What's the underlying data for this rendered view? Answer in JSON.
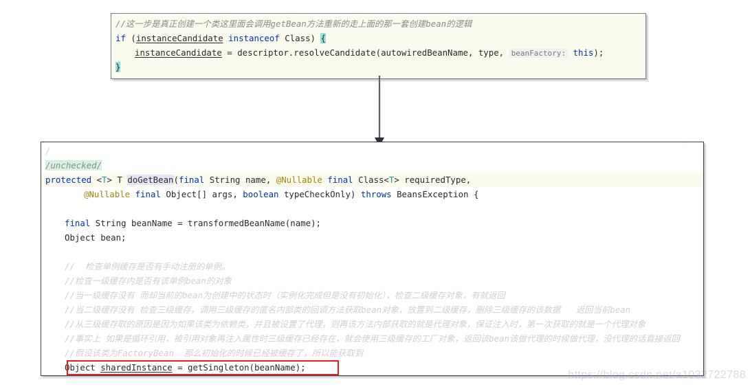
{
  "meta": {
    "watermark": "https://blog.csdn.net/a1032722788",
    "accent_red": "#ee1b24",
    "comment_color": "#8c8c8c",
    "keyword_color": "#0033b3",
    "annotation_color": "#9e880d",
    "faded_comment_color": "#cfcfd6",
    "panel_border": "#3d4046",
    "brace_highlight": "#99e0d8"
  },
  "top_panel": {
    "name": "resolveCandidate snippet",
    "lines": [
      {
        "id": "t1",
        "indent": 0,
        "highlight": "cream",
        "tokens": [
          {
            "t": "//这一步是真正创建一个类这里面会调用getBean方法重新的走上面的那一套创建bean的逻辑",
            "c": "cmt"
          }
        ]
      },
      {
        "id": "t2",
        "indent": 0,
        "highlight": "cream",
        "tokens": [
          {
            "t": "if ",
            "c": "kw"
          },
          {
            "t": "(",
            "c": "plain"
          },
          {
            "t": "instanceCandidate",
            "c": "fld"
          },
          {
            "t": " ",
            "c": "plain"
          },
          {
            "t": "instanceof",
            "c": "kw"
          },
          {
            "t": " Class) ",
            "c": "plain"
          },
          {
            "t": "{",
            "c": "brace"
          }
        ]
      },
      {
        "id": "t3",
        "indent": 1,
        "highlight": "cream",
        "tokens": [
          {
            "t": "instanceCandidate",
            "c": "fld"
          },
          {
            "t": " = descriptor.resolveCandidate(autowiredBeanName, type, ",
            "c": "plain"
          },
          {
            "t": "beanFactory:",
            "c": "hint"
          },
          {
            "t": "this",
            "c": "kw"
          },
          {
            "t": ");",
            "c": "plain"
          }
        ]
      },
      {
        "id": "t4",
        "indent": 0,
        "highlight": "cream",
        "tokens": [
          {
            "t": "}",
            "c": "brace"
          }
        ]
      }
    ]
  },
  "bottom_panel": {
    "name": "doGetBean method",
    "lines": [
      {
        "id": "b0",
        "indent": 0,
        "highlight": "white",
        "tokens": [
          {
            "t": "/",
            "c": "plain-faint"
          }
        ]
      },
      {
        "id": "b1",
        "indent": 0,
        "highlight": "white",
        "tokens": [
          {
            "t": "/unchecked/",
            "c": "cmt-green"
          }
        ]
      },
      {
        "id": "b2",
        "indent": 0,
        "highlight": "cream",
        "tokens": [
          {
            "t": "protected",
            "c": "kw"
          },
          {
            "t": " <",
            "c": "plain"
          },
          {
            "t": "T",
            "c": "gen"
          },
          {
            "t": "> T ",
            "c": "plain"
          },
          {
            "t": "doGetBean",
            "c": "sel"
          },
          {
            "t": "(",
            "c": "plain"
          },
          {
            "t": "final",
            "c": "kw"
          },
          {
            "t": " String name, ",
            "c": "plain"
          },
          {
            "t": "@Nullable",
            "c": "anno"
          },
          {
            "t": " ",
            "c": "plain"
          },
          {
            "t": "final",
            "c": "kw"
          },
          {
            "t": " Class<",
            "c": "plain"
          },
          {
            "t": "T",
            "c": "gen"
          },
          {
            "t": "> requiredType,",
            "c": "plain"
          }
        ]
      },
      {
        "id": "b3",
        "indent": 2,
        "highlight": "white",
        "tokens": [
          {
            "t": "@Nullable",
            "c": "anno"
          },
          {
            "t": " ",
            "c": "plain"
          },
          {
            "t": "final",
            "c": "kw"
          },
          {
            "t": " Object[] args, ",
            "c": "plain"
          },
          {
            "t": "boolean",
            "c": "kw"
          },
          {
            "t": " typeCheckOnly) ",
            "c": "plain"
          },
          {
            "t": "throws",
            "c": "kw"
          },
          {
            "t": " BeansException {",
            "c": "plain"
          }
        ]
      },
      {
        "id": "b4",
        "indent": 0,
        "highlight": "white",
        "tokens": []
      },
      {
        "id": "b5",
        "indent": 1,
        "highlight": "white",
        "tokens": [
          {
            "t": "final",
            "c": "kw"
          },
          {
            "t": " String beanName = transformedBeanName(name);",
            "c": "plain"
          }
        ]
      },
      {
        "id": "b6",
        "indent": 1,
        "highlight": "white",
        "tokens": [
          {
            "t": "Object bean;",
            "c": "plain"
          }
        ]
      },
      {
        "id": "b7",
        "indent": 0,
        "highlight": "white",
        "tokens": []
      },
      {
        "id": "b8",
        "indent": 1,
        "highlight": "white",
        "tokens": [
          {
            "t": "//  检查单例缓存是否有手动注册的单例。",
            "c": "cmt-cn"
          }
        ]
      },
      {
        "id": "b9",
        "indent": 1,
        "highlight": "white",
        "tokens": [
          {
            "t": "//检查一级缓存内是否有该单例bean的对象",
            "c": "cmt-cn"
          }
        ]
      },
      {
        "id": "b10",
        "indent": 1,
        "highlight": "white",
        "tokens": [
          {
            "t": "//当一级缓存没有 而却当前的bean为创建中的状态时（实例化完成但是没有初始化），检查二级缓存对象，有就返回",
            "c": "cmt-cn"
          }
        ]
      },
      {
        "id": "b11",
        "indent": 1,
        "highlight": "white",
        "tokens": [
          {
            "t": "//当二级缓存没有 检查三级缓存，调用三级缓存的匿名内部类的回调方法获取bean对象，放置到二级缓存，删除三级缓存的该数据   返回当前bean",
            "c": "cmt-cn"
          }
        ]
      },
      {
        "id": "b12",
        "indent": 1,
        "highlight": "white",
        "tokens": [
          {
            "t": "//从三级缓存取的原因是因为如果该类为依赖类，并且被设置了代理，则再该方法内部获取的就是代理对象，保证注入时，第一次获取的就是一个代理对象",
            "c": "cmt-cn"
          }
        ]
      },
      {
        "id": "b13",
        "indent": 1,
        "highlight": "white",
        "tokens": [
          {
            "t": "//事实上 如果是循环引用，被引用对象再注入属性时三级缓存已经存在，就会使用三级缓存的工厂对象，返回该bean该做代理的时候做代理，没代理的话直接返回",
            "c": "cmt-cn"
          }
        ]
      },
      {
        "id": "b14",
        "indent": 1,
        "highlight": "white",
        "tokens": [
          {
            "t": "//假设该类为FactoryBean  那么初始化的时候已经被缓存了，所以能获取到",
            "c": "cmt-cn"
          }
        ]
      },
      {
        "id": "b15",
        "indent": 1,
        "highlight": "white",
        "boxed": true,
        "tokens": [
          {
            "t": "Object ",
            "c": "plain"
          },
          {
            "t": "sharedInstance",
            "c": "fld"
          },
          {
            "t": " = getSingleton(beanName);",
            "c": "plain"
          }
        ]
      }
    ]
  },
  "connector": {
    "name": "flow arrow from top snippet to doGetBean",
    "label": ""
  }
}
